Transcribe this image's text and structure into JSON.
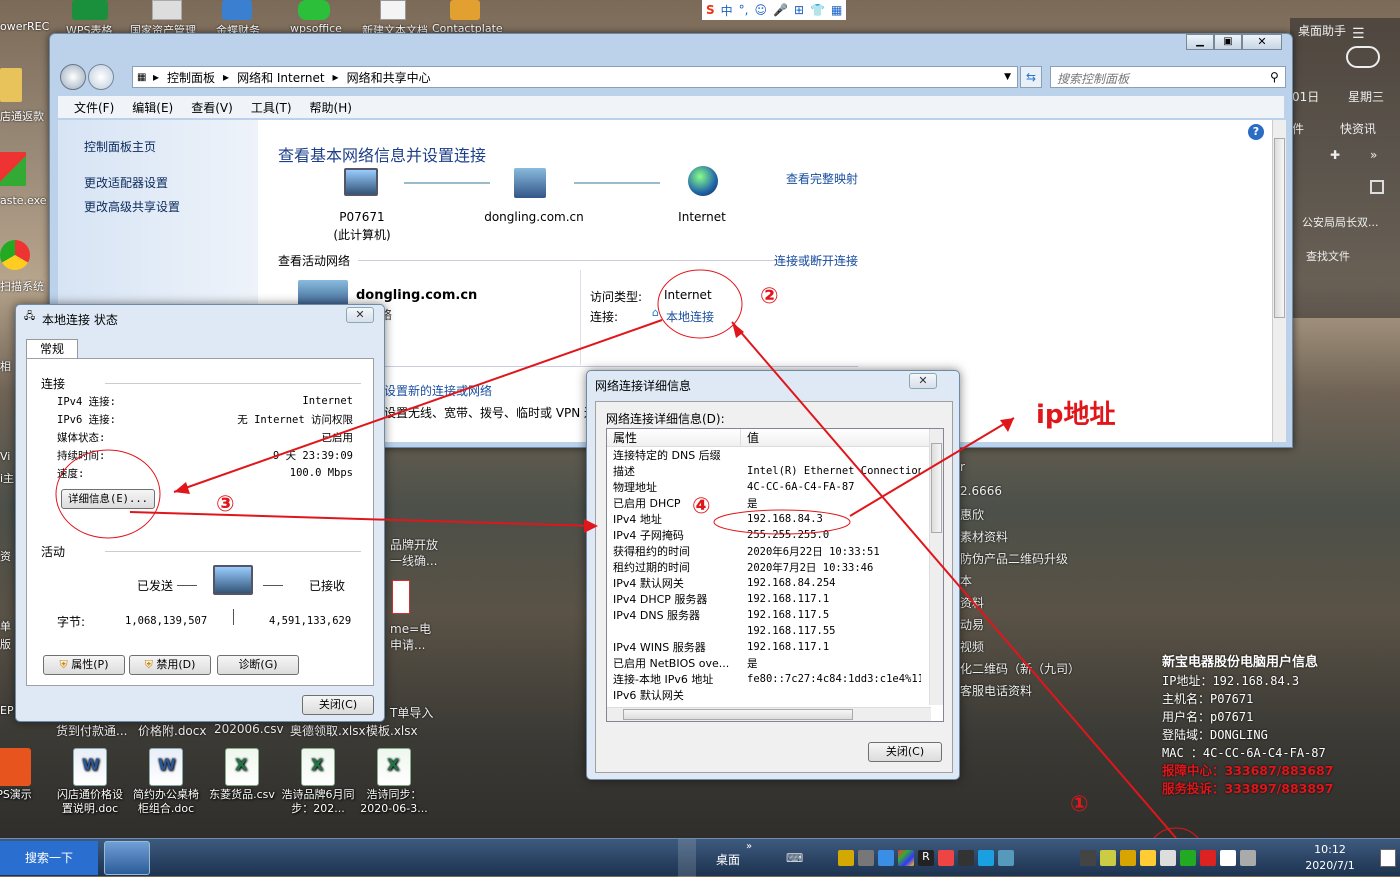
{
  "desktop": {
    "left_icons": [
      {
        "label": "owerREC"
      },
      {
        "label": "店通返款"
      },
      {
        "label": "aste.exe"
      },
      {
        "label": "扫描系统"
      }
    ],
    "top_icons": [
      "WPS表格",
      "国家资产管理",
      "金蝶财务",
      "wpsoffice",
      "新建文本文档",
      "Contactplate"
    ],
    "bottom_icons": [
      {
        "label": "PS演示",
        "type": "ppt"
      },
      {
        "label": "闪店通价格设置说明.doc",
        "type": "word"
      },
      {
        "label": "简约办公桌椅柜组合.doc",
        "type": "word"
      },
      {
        "label": "东菱货品.csv",
        "type": "xls"
      },
      {
        "label": "浩诗品牌6月同步：202...",
        "type": "xls"
      },
      {
        "label": "浩诗同步：2020-06-3...",
        "type": "xls"
      }
    ],
    "mid_labels": [
      "货到付款通...",
      "价格附.docx",
      "202006.csv",
      "奥德领取.xlsx",
      "模板.xlsx"
    ],
    "behind_texts": [
      "品牌开放",
      "一线确...",
      "me=电",
      "申请...",
      "T单导入",
      "r",
      "2.6666",
      "惠欣",
      "素材资料",
      "防伪产品二维码升级",
      "本",
      "资料",
      "动易",
      "视频",
      "化二维码（新（九司）",
      "客服电话资料"
    ],
    "left_partial": [
      "相",
      "Vi",
      "i主",
      "资",
      "单",
      "版",
      "EP"
    ]
  },
  "sogou": {
    "label": "中",
    "items": [
      "°,",
      "☺",
      "🎤",
      "⊞",
      "👕",
      "▦"
    ]
  },
  "right_panel": {
    "date": "01日",
    "weekday": "星期三",
    "title": "桌面助手",
    "quick1": "件",
    "quick2": "快资讯",
    "news": "公安局局长双...",
    "find": "查找文件"
  },
  "main_window": {
    "breadcrumb": [
      "控制面板",
      "网络和 Internet",
      "网络和共享中心"
    ],
    "search_placeholder": "搜索控制面板",
    "menu": [
      "文件(F)",
      "编辑(E)",
      "查看(V)",
      "工具(T)",
      "帮助(H)"
    ],
    "left_links": [
      "控制面板主页",
      "更改适配器设置",
      "更改高级共享设置"
    ],
    "heading": "查看基本网络信息并设置连接",
    "view_full_map": "查看完整映射",
    "nodes": [
      {
        "name": "P07671",
        "sub": "(此计算机)"
      },
      {
        "name": "dongling.com.cn",
        "sub": ""
      },
      {
        "name": "Internet",
        "sub": ""
      }
    ],
    "active_label": "查看活动网络",
    "connect_link": "连接或断开连接",
    "network_name": "dongling.com.cn",
    "network_sub": "域网络",
    "access_type_label": "访问类型:",
    "access_type_value": "Internet",
    "connection_label": "连接:",
    "connection_value": "本地连接",
    "change_settings": "设置新的连接或网络",
    "change_desc": "设置无线、宽带、拨号、临时或 VPN 连接；或设置路由器或访问点。"
  },
  "status_dialog": {
    "title": "本地连接 状态",
    "tab": "常规",
    "section_conn": "连接",
    "rows": [
      {
        "k": "IPv4 连接:",
        "v": "Internet"
      },
      {
        "k": "IPv6 连接:",
        "v": "无 Internet 访问权限"
      },
      {
        "k": "媒体状态:",
        "v": "已启用"
      },
      {
        "k": "持续时间:",
        "v": "9 天 23:39:09"
      },
      {
        "k": "速度:",
        "v": "100.0 Mbps"
      }
    ],
    "details_btn": "详细信息(E)...",
    "section_activity": "活动",
    "sent_label": "已发送",
    "recv_label": "已接收",
    "bytes_label": "字节:",
    "bytes_sent": "1,068,139,507",
    "bytes_recv": "4,591,133,629",
    "btn_props": "属性(P)",
    "btn_disable": "禁用(D)",
    "btn_diag": "诊断(G)",
    "btn_close": "关闭(C)"
  },
  "details_dialog": {
    "title": "网络连接详细信息",
    "label": "网络连接详细信息(D):",
    "col_prop": "属性",
    "col_val": "值",
    "rows": [
      {
        "k": "连接特定的 DNS 后缀",
        "v": ""
      },
      {
        "k": "描述",
        "v": "Intel(R) Ethernet Connection ("
      },
      {
        "k": "物理地址",
        "v": "4C-CC-6A-C4-FA-87"
      },
      {
        "k": "已启用 DHCP",
        "v": "是"
      },
      {
        "k": "IPv4 地址",
        "v": "192.168.84.3"
      },
      {
        "k": "IPv4 子网掩码",
        "v": "255.255.255.0"
      },
      {
        "k": "获得租约的时间",
        "v": "2020年6月22日 10:33:51"
      },
      {
        "k": "租约过期的时间",
        "v": "2020年7月2日 10:33:46"
      },
      {
        "k": "IPv4 默认网关",
        "v": "192.168.84.254"
      },
      {
        "k": "IPv4 DHCP 服务器",
        "v": "192.168.117.1"
      },
      {
        "k": "IPv4 DNS 服务器",
        "v": "192.168.117.5"
      },
      {
        "k": "",
        "v": "192.168.117.55"
      },
      {
        "k": "IPv4 WINS 服务器",
        "v": "192.168.117.1"
      },
      {
        "k": "已启用 NetBIOS ove...",
        "v": "是"
      },
      {
        "k": "连接-本地 IPv6 地址",
        "v": "fe80::7c27:4c84:1dd3:c1e4%11"
      },
      {
        "k": "IPv6 默认网关",
        "v": ""
      }
    ],
    "btn_close": "关闭(C)"
  },
  "annotations": {
    "ip_label": "ip地址",
    "n1": "①",
    "n2": "②",
    "n3": "③",
    "n4": "④",
    "color": "#e0161b"
  },
  "info_overlay": {
    "title": "新宝电器股份电脑用户信息",
    "ip": "IP地址：192.168.84.3",
    "host": "主机名：P07671",
    "user": "用户名：p07671",
    "domain": "登陆域：DONGLING",
    "mac": "MAC  ：4C-CC-6A-C4-FA-87",
    "support": "报障中心：333687/883687",
    "service": "服务投诉：333897/883897"
  },
  "taskbar": {
    "start": "搜索一下",
    "desktop": "桌面",
    "time": "10:12",
    "date": "2020/7/1"
  }
}
